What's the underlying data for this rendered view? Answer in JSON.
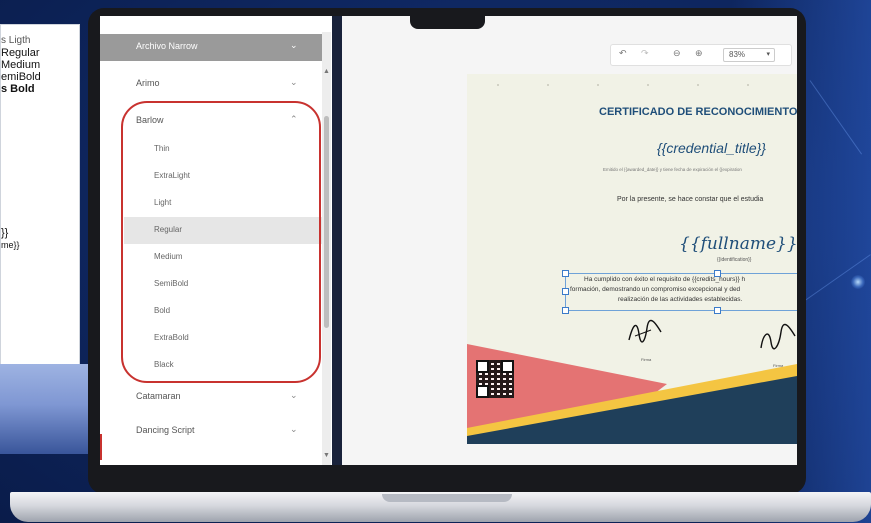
{
  "left_panel": {
    "lines": [
      "s Ligth",
      "Regular",
      "Medium",
      "emiBold",
      "s Bold",
      "}}",
      "me}}"
    ]
  },
  "sidebar": {
    "fonts": [
      {
        "label": "Archivo Narrow",
        "expanded": false,
        "header": true
      },
      {
        "label": "Arimo",
        "expanded": false
      },
      {
        "label": "Barlow",
        "expanded": true
      },
      {
        "label": "Catamaran",
        "expanded": false
      },
      {
        "label": "Dancing Script",
        "expanded": false
      }
    ],
    "weights": [
      "Thin",
      "ExtraLight",
      "Light",
      "Regular",
      "Medium",
      "SemiBold",
      "Bold",
      "ExtraBold",
      "Black"
    ],
    "selected_weight": "Regular",
    "colors": {
      "highlight": "#c8322f",
      "header_bg": "#9a9a9a"
    }
  },
  "icons": {
    "chevron_down": "⌄",
    "chevron_up": "⌃",
    "undo": "↶",
    "redo": "↷",
    "zoom_out": "⊖",
    "zoom_in": "⊕",
    "dropdown": "▾",
    "scroll_up": "▲",
    "scroll_down": "▼"
  },
  "toolbar": {
    "zoom_value": "83%"
  },
  "certificate": {
    "title": "CERTIFICADO DE RECONOCIMIENTO",
    "credential_placeholder": "{{credential_title}}",
    "small_line": "Emitido el {{awarded_date}} y tiene fecha de expiración el {{expiration",
    "intro": "Por la presente, se hace constar que el estudia",
    "fullname_placeholder": "{{fullname}}",
    "identification_placeholder": "{{identification}}",
    "body_lines": [
      "Ha cumplido con éxito el requisito de {{credits_hours}} h",
      "formación, demostrando un compromiso excepcional y ded",
      "realización de las actividades establecidas."
    ],
    "signature_1": "Firma",
    "signature_2": "Firma",
    "colors": {
      "title": "#1f4e79",
      "band_pink": "#e47373",
      "band_yellow": "#f4c542",
      "band_navy": "#1f3f5a",
      "bg": "#f1f2e6"
    }
  }
}
